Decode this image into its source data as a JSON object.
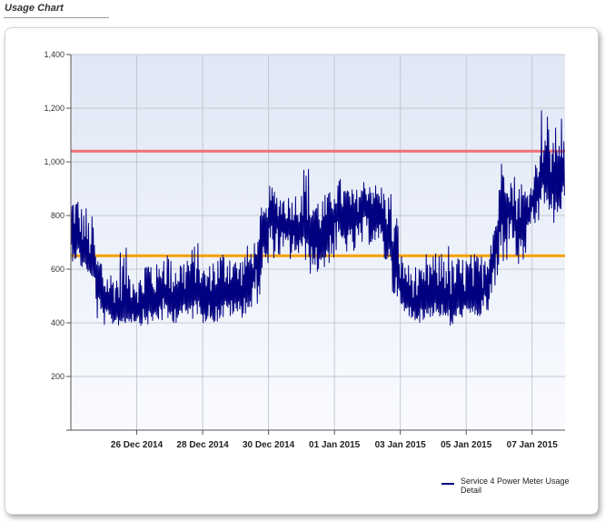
{
  "header": {
    "title": "Usage Chart"
  },
  "chart_data": {
    "type": "line",
    "title": "",
    "xlabel": "",
    "ylabel": "",
    "ylim": [
      0,
      1400
    ],
    "y_ticks": [
      {
        "value": 200,
        "label": "200"
      },
      {
        "value": 400,
        "label": "400"
      },
      {
        "value": 600,
        "label": "600"
      },
      {
        "value": 800,
        "label": "800"
      },
      {
        "value": 1000,
        "label": "1,000"
      },
      {
        "value": 1200,
        "label": "1,200"
      },
      {
        "value": 1400,
        "label": "1,400"
      }
    ],
    "xlim": [
      "2014-12-24T00:00",
      "2015-01-08T00:00"
    ],
    "x_ticks": [
      {
        "value": "2014-12-26",
        "label": "26 Dec 2014"
      },
      {
        "value": "2014-12-28",
        "label": "28 Dec 2014"
      },
      {
        "value": "2014-12-30",
        "label": "30 Dec 2014"
      },
      {
        "value": "2015-01-01",
        "label": "01 Jan 2015"
      },
      {
        "value": "2015-01-03",
        "label": "03 Jan 2015"
      },
      {
        "value": "2015-01-05",
        "label": "05 Jan 2015"
      },
      {
        "value": "2015-01-07",
        "label": "07 Jan 2015"
      }
    ],
    "grid": true,
    "legend_position": "bottom-right",
    "thresholds": [
      {
        "value": 1040,
        "color": "#f07070"
      },
      {
        "value": 650,
        "color": "#f5a000"
      }
    ],
    "series": [
      {
        "name": "Service 4 Power Meter Usage Detail",
        "color": "#000080",
        "x": [
          "2014-12-24T00:00",
          "2014-12-24T06:00",
          "2014-12-24T12:00",
          "2014-12-24T18:00",
          "2014-12-25T00:00",
          "2014-12-25T06:00",
          "2014-12-25T12:00",
          "2014-12-25T18:00",
          "2014-12-26T00:00",
          "2014-12-26T06:00",
          "2014-12-26T12:00",
          "2014-12-26T18:00",
          "2014-12-27T00:00",
          "2014-12-27T06:00",
          "2014-12-27T12:00",
          "2014-12-27T18:00",
          "2014-12-28T00:00",
          "2014-12-28T06:00",
          "2014-12-28T12:00",
          "2014-12-28T18:00",
          "2014-12-29T00:00",
          "2014-12-29T06:00",
          "2014-12-29T12:00",
          "2014-12-29T18:00",
          "2014-12-30T00:00",
          "2014-12-30T06:00",
          "2014-12-30T12:00",
          "2014-12-30T18:00",
          "2014-12-31T00:00",
          "2014-12-31T06:00",
          "2014-12-31T12:00",
          "2014-12-31T18:00",
          "2015-01-01T00:00",
          "2015-01-01T06:00",
          "2015-01-01T12:00",
          "2015-01-01T18:00",
          "2015-01-02T00:00",
          "2015-01-02T06:00",
          "2015-01-02T12:00",
          "2015-01-02T18:00",
          "2015-01-03T00:00",
          "2015-01-03T06:00",
          "2015-01-03T12:00",
          "2015-01-03T18:00",
          "2015-01-04T00:00",
          "2015-01-04T06:00",
          "2015-01-04T12:00",
          "2015-01-04T18:00",
          "2015-01-05T00:00",
          "2015-01-05T06:00",
          "2015-01-05T12:00",
          "2015-01-05T18:00",
          "2015-01-06T00:00",
          "2015-01-06T06:00",
          "2015-01-06T12:00",
          "2015-01-06T18:00",
          "2015-01-07T00:00",
          "2015-01-07T06:00",
          "2015-01-07T12:00",
          "2015-01-07T18:00"
        ],
        "values": [
          740,
          700,
          620,
          560,
          470,
          450,
          440,
          460,
          450,
          470,
          460,
          520,
          470,
          490,
          480,
          520,
          470,
          490,
          480,
          510,
          490,
          520,
          560,
          690,
          800,
          780,
          760,
          760,
          750,
          720,
          700,
          720,
          810,
          790,
          770,
          800,
          830,
          800,
          780,
          650,
          520,
          480,
          460,
          470,
          500,
          490,
          460,
          480,
          480,
          470,
          500,
          600,
          810,
          860,
          750,
          760,
          850,
          960,
          880,
          940
        ],
        "min_values": [
          630,
          600,
          570,
          400,
          390,
          390,
          390,
          400,
          390,
          390,
          400,
          400,
          400,
          420,
          410,
          430,
          400,
          400,
          410,
          420,
          420,
          430,
          470,
          560,
          640,
          640,
          630,
          640,
          630,
          580,
          590,
          620,
          650,
          660,
          650,
          680,
          690,
          660,
          620,
          500,
          420,
          410,
          400,
          420,
          420,
          400,
          380,
          420,
          420,
          420,
          430,
          480,
          620,
          700,
          600,
          650,
          740,
          840,
          760,
          780
        ],
        "max_values": [
          880,
          840,
          800,
          660,
          600,
          600,
          680,
          620,
          580,
          660,
          620,
          690,
          640,
          650,
          680,
          700,
          620,
          660,
          680,
          690,
          650,
          690,
          710,
          830,
          910,
          890,
          880,
          890,
          990,
          900,
          880,
          890,
          940,
          920,
          900,
          940,
          950,
          920,
          900,
          810,
          660,
          620,
          600,
          660,
          660,
          700,
          640,
          650,
          660,
          660,
          690,
          780,
          1010,
          960,
          940,
          920,
          1000,
          1210,
          1130,
          1190
        ]
      }
    ]
  }
}
